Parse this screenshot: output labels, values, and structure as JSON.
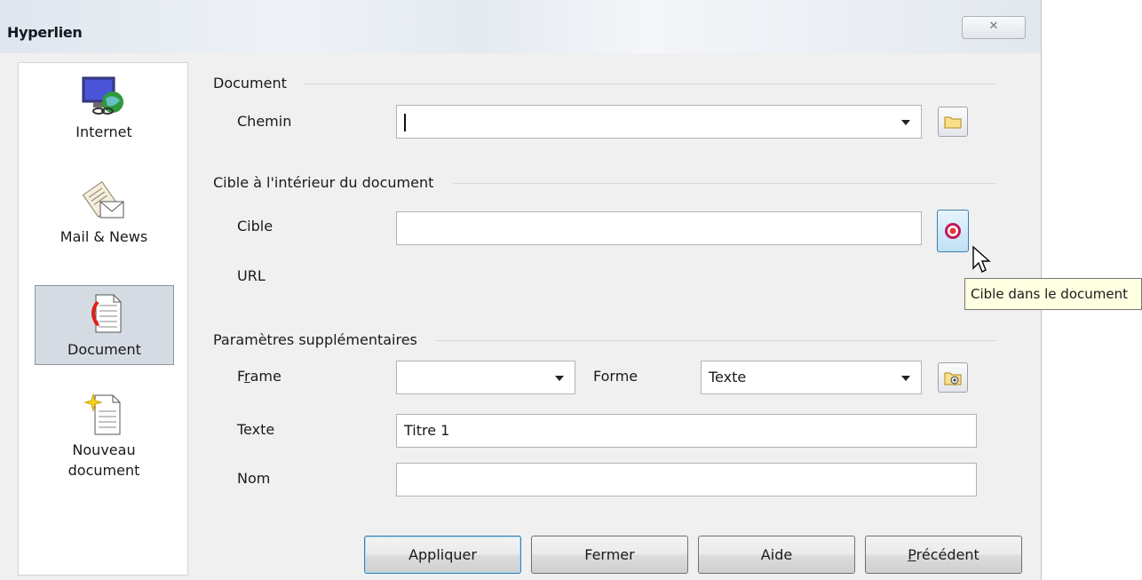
{
  "dialog": {
    "title": "Hyperlien",
    "close_glyph": "✕"
  },
  "sidebar": {
    "items": [
      {
        "label": "Internet",
        "icon": "internet-globe-icon",
        "active": false
      },
      {
        "label": "Mail & News",
        "icon": "mail-envelope-icon",
        "active": false
      },
      {
        "label": "Document",
        "icon": "document-icon",
        "active": true
      },
      {
        "label_line1": "Nouveau",
        "label_line2": "document",
        "icon": "new-document-icon",
        "active": false
      }
    ]
  },
  "document_section": {
    "heading": "Document",
    "path_label": "Chemin",
    "path_value": ""
  },
  "target_section": {
    "heading": "Cible à l'intérieur du document",
    "target_label": "Cible",
    "target_value": "",
    "url_label": "URL",
    "target_button_tooltip": "Cible dans le document"
  },
  "extra_section": {
    "heading": "Paramètres supplémentaires",
    "frame_label_prefix": "F",
    "frame_label_accel": "r",
    "frame_label_suffix": "ame",
    "frame_value": "",
    "form_label": "Forme",
    "form_value": "Texte",
    "text_label": "Texte",
    "text_value": "Titre 1",
    "name_label": "Nom",
    "name_value": ""
  },
  "buttons": {
    "apply": "Appliquer",
    "close": "Fermer",
    "help": "Aide",
    "previous_accel": "P",
    "previous_rest": "récédent"
  },
  "colors": {
    "active_nav_bg": "#d5dbe2",
    "tooltip_bg": "#ffffe1",
    "hot_button": "#bfe1f6"
  }
}
